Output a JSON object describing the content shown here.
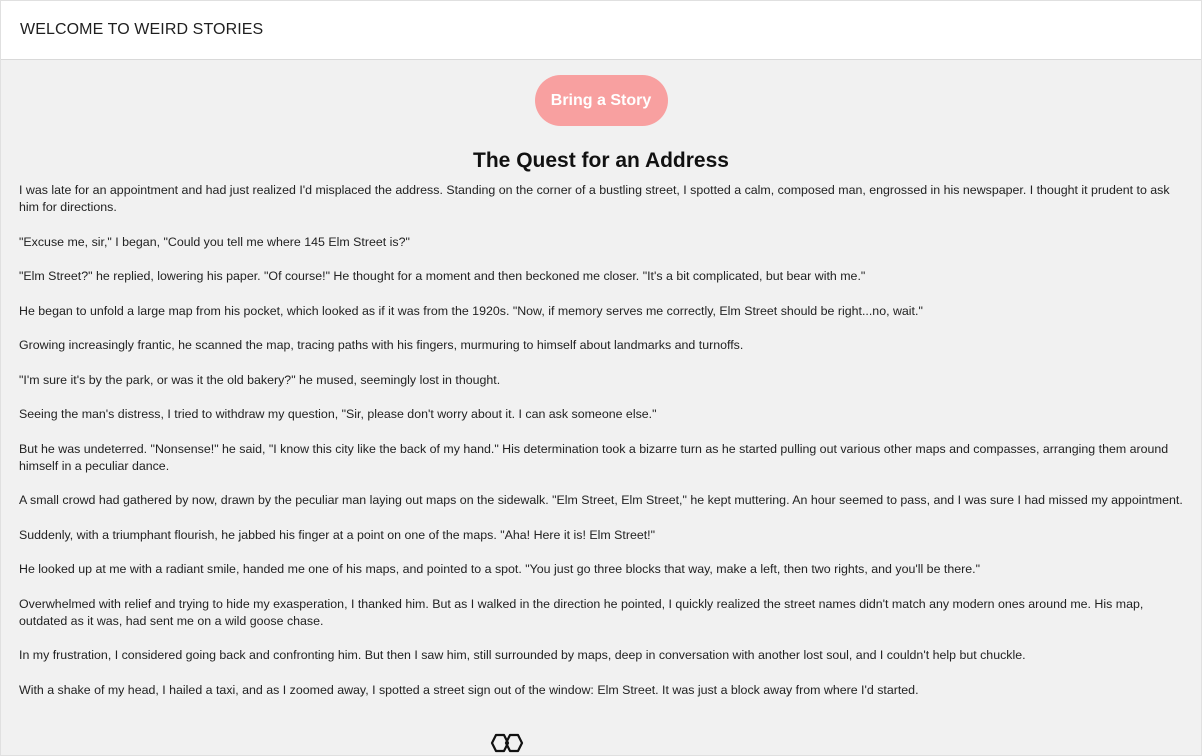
{
  "header": {
    "title": "WELCOME TO WEIRD STORIES"
  },
  "actions": {
    "bring_story_label": "Bring a Story"
  },
  "story": {
    "title": "The Quest for an Address",
    "paragraphs": [
      "I was late for an appointment and had just realized I'd misplaced the address. Standing on the corner of a bustling street, I spotted a calm, composed man, engrossed in his newspaper. I thought it prudent to ask him for directions.",
      "\"Excuse me, sir,\" I began, \"Could you tell me where 145 Elm Street is?\"",
      "\"Elm Street?\" he replied, lowering his paper. \"Of course!\" He thought for a moment and then beckoned me closer. \"It's a bit complicated, but bear with me.\"",
      "He began to unfold a large map from his pocket, which looked as if it was from the 1920s. \"Now, if memory serves me correctly, Elm Street should be right...no, wait.\"",
      "Growing increasingly frantic, he scanned the map, tracing paths with his fingers, murmuring to himself about landmarks and turnoffs.",
      "\"I'm sure it's by the park, or was it the old bakery?\" he mused, seemingly lost in thought.",
      "Seeing the man's distress, I tried to withdraw my question, \"Sir, please don't worry about it. I can ask someone else.\"",
      "But he was undeterred. \"Nonsense!\" he said, \"I know this city like the back of my hand.\" His determination took a bizarre turn as he started pulling out various other maps and compasses, arranging them around himself in a peculiar dance.",
      "A small crowd had gathered by now, drawn by the peculiar man laying out maps on the sidewalk. \"Elm Street, Elm Street,\" he kept muttering. An hour seemed to pass, and I was sure I had missed my appointment.",
      "Suddenly, with a triumphant flourish, he jabbed his finger at a point on one of the maps. \"Aha! Here it is! Elm Street!\"",
      "He looked up at me with a radiant smile, handed me one of his maps, and pointed to a spot. \"You just go three blocks that way, make a left, then two rights, and you'll be there.\"",
      "Overwhelmed with relief and trying to hide my exasperation, I thanked him. But as I walked in the direction he pointed, I quickly realized the street names didn't match any modern ones around me. His map, outdated as it was, had sent me on a wild goose chase.",
      "In my frustration, I considered going back and confronting him. But then I saw him, still surrounded by maps, deep in conversation with another lost soul, and I couldn't help but chuckle.",
      "With a shake of my head, I hailed a taxi, and as I zoomed away, I spotted a street sign out of the window: Elm Street. It was just a block away from where I'd started."
    ]
  },
  "footer": {
    "logo_icon": "linked-hexagons-icon"
  },
  "colors": {
    "button_bg": "#f8a0a0",
    "page_bg": "#f1f1f1",
    "header_bg": "#ffffff"
  }
}
